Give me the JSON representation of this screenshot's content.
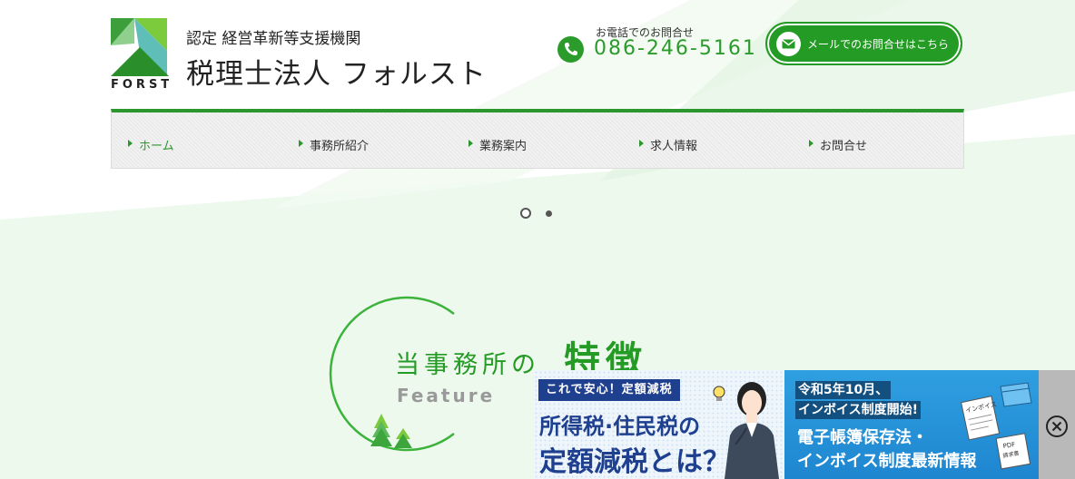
{
  "header": {
    "logo_text": "FORST",
    "certification": "認定 経営革新等支援機関",
    "firm_name": "税理士法人 フォルスト",
    "phone_label": "お電話でのお問合せ",
    "phone_number": "086-246-5161",
    "mail_button_label": "メールでのお問合せはこちら"
  },
  "nav": {
    "items": [
      {
        "label": "ホーム",
        "active": true
      },
      {
        "label": "事務所紹介"
      },
      {
        "label": "業務案内"
      },
      {
        "label": "求人情報"
      },
      {
        "label": "お問合せ"
      }
    ]
  },
  "slider": {
    "dot_count": 2,
    "active_index": 0
  },
  "feature": {
    "title_prefix": "当事務所の",
    "title_main": "特徴",
    "subtitle": "Feature"
  },
  "banner": {
    "tag": "これで安心！定額減税",
    "line1": "所得税·住民税の",
    "line2": "定額減税とは？",
    "right_line1": "令和5年10月、",
    "right_line2": "インボイス制度開始!",
    "right_line3": "電子帳簿保存法・",
    "right_line4": "インボイス制度最新情報",
    "doc_label1": "インボイス",
    "doc_label2": "PDF",
    "doc_label3": "請求書"
  },
  "colors": {
    "brand_green": "#249b24",
    "banner_navy": "#1f3f8f",
    "banner_blue": "#1e86d0"
  },
  "icons": [
    "phone-icon",
    "mail-icon",
    "close-icon",
    "tree-icon"
  ]
}
